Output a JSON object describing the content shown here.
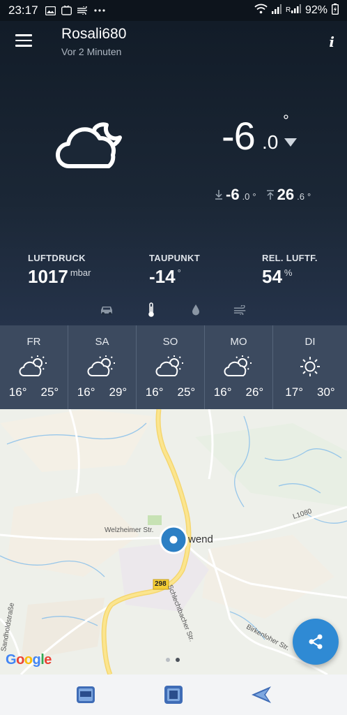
{
  "status_bar": {
    "time": "23:17",
    "battery": "92%",
    "icons": [
      "image-icon",
      "tv-icon",
      "wind-icon",
      "more-icon",
      "wifi-icon",
      "signal-icon",
      "signal2-icon",
      "battery-icon"
    ]
  },
  "header": {
    "station_name": "Rosali680",
    "updated": "Vor 2 Minuten",
    "info_label": "i"
  },
  "current": {
    "icon": "partly-cloudy-night-icon",
    "temp_int": "-6",
    "temp_dec": ".0",
    "temp_deg": "°",
    "trend": "down",
    "min_int": "-6",
    "min_dec": ".0",
    "min_deg": "°",
    "max_int": "26",
    "max_dec": ".6",
    "max_deg": "°"
  },
  "metrics": [
    {
      "label": "LUFTDRUCK",
      "value": "1017",
      "unit": "mbar"
    },
    {
      "label": "TAUPUNKT",
      "value": "-14",
      "unit": "°"
    },
    {
      "label": "REL. LUFTF.",
      "value": "54",
      "unit": "%"
    }
  ],
  "tab_icons": [
    "car-icon",
    "thermometer-icon",
    "drop-icon",
    "wind-icon"
  ],
  "forecast": [
    {
      "day": "FR",
      "icon": "partly-cloudy-sun-icon",
      "min": "16°",
      "max": "25°"
    },
    {
      "day": "SA",
      "icon": "partly-cloudy-sun-icon",
      "min": "16°",
      "max": "29°"
    },
    {
      "day": "SO",
      "icon": "partly-cloudy-sun-icon",
      "min": "16°",
      "max": "25°"
    },
    {
      "day": "MO",
      "icon": "partly-cloudy-sun-icon",
      "min": "16°",
      "max": "26°"
    },
    {
      "day": "DI",
      "icon": "sun-icon",
      "min": "17°",
      "max": "30°"
    }
  ],
  "map": {
    "labels": {
      "street1": "Welzheimer Str.",
      "town": "wend",
      "street2": "Schlechtbacher Str.",
      "road_number": "298",
      "road2": "L1080",
      "street3": "Birkenloher Str.",
      "street4": "Sandholdstraße"
    },
    "google": [
      "G",
      "o",
      "o",
      "g",
      "l",
      "e"
    ],
    "page_count": 2,
    "active_page": 2
  },
  "colors": {
    "accent": "#2f8ad4",
    "forecast_bg": "#3c4a5f",
    "google": [
      "#4285F4",
      "#EA4335",
      "#FBBC05",
      "#4285F4",
      "#34A853",
      "#EA4335"
    ]
  }
}
